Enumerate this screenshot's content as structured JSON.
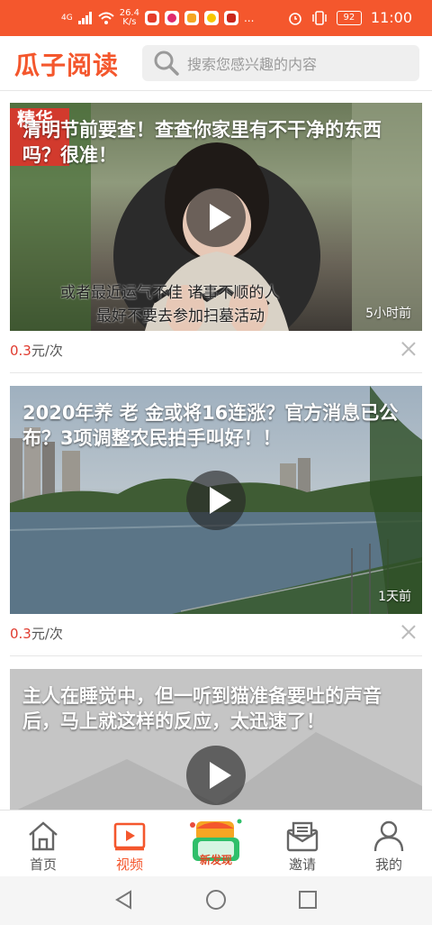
{
  "status_bar": {
    "network": "4G",
    "speed": "26.4",
    "speed_unit": "K/s",
    "icons": [
      "signal-icon",
      "wifi-icon",
      "app-icons",
      "alarm-icon",
      "vibrate-icon"
    ],
    "more": "...",
    "battery": "92",
    "time": "11:00",
    "bg_color": "#f4572d"
  },
  "header": {
    "logo": "瓜子阅读",
    "search_placeholder": "搜索您感兴趣的内容",
    "accent_color": "#f4572d"
  },
  "feed": {
    "items": [
      {
        "title": "清明节前要查！查查你家里有不干净的东西吗？很准！",
        "badge": "精华",
        "subtitle_line1": "或者最近运气不佳 诸事不顺的人",
        "subtitle_line2": "最好不要去参加扫墓活动",
        "time": "5小时前",
        "price": "0.3",
        "price_unit": "元/次"
      },
      {
        "title": "2020年养 老 金或将16连涨？官方消息已公布？3项调整农民拍手叫好！！",
        "time": "1天前",
        "price": "0.3",
        "price_unit": "元/次"
      },
      {
        "title": "主人在睡觉中，但一听到猫准备要吐的声音后，马上就这样的反应，太迅速了！"
      }
    ]
  },
  "tabbar": {
    "tabs": [
      {
        "label": "首页",
        "icon": "home-icon"
      },
      {
        "label": "视频",
        "icon": "video-icon",
        "active": true
      },
      {
        "label": "新发现",
        "icon": "treasure-chest-icon"
      },
      {
        "label": "邀请",
        "icon": "invite-icon"
      },
      {
        "label": "我的",
        "icon": "profile-icon"
      }
    ]
  },
  "nav": {
    "buttons": [
      "back-icon",
      "home-circle-icon",
      "recents-icon"
    ]
  }
}
